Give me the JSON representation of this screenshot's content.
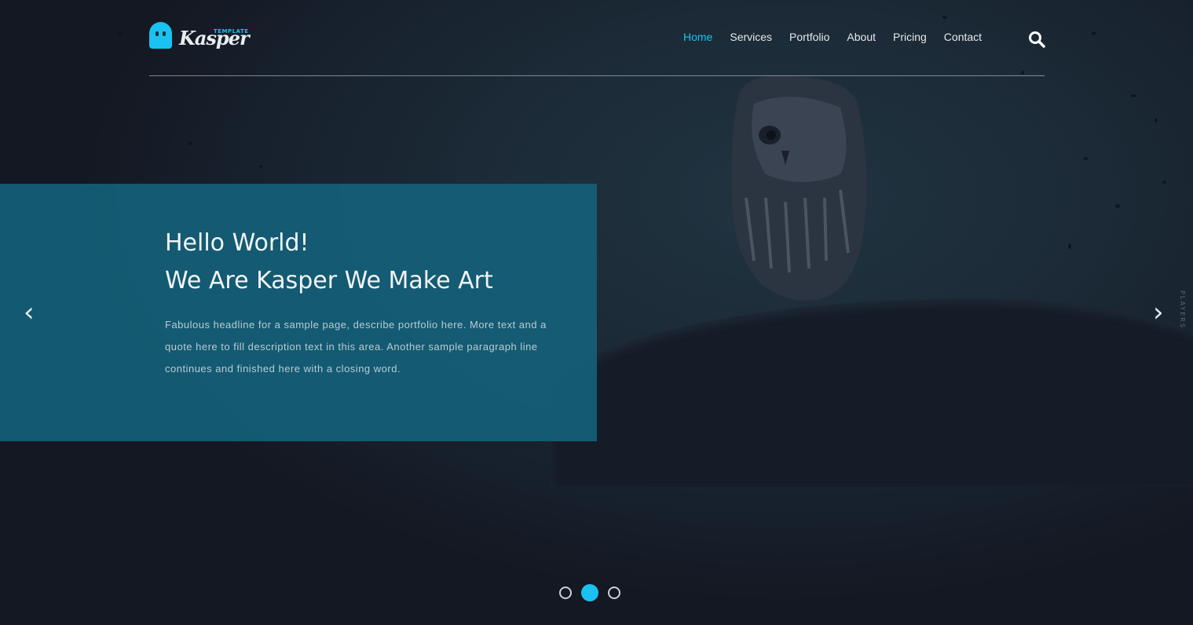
{
  "colors": {
    "accent": "#19c2f0",
    "caption_bg": "#145f78",
    "page_bg": "#141822"
  },
  "logo": {
    "text": "Kasper",
    "subtext": "TEMPLATE"
  },
  "nav": {
    "items": [
      {
        "label": "Home",
        "active": true
      },
      {
        "label": "Services",
        "active": false
      },
      {
        "label": "Portfolio",
        "active": false
      },
      {
        "label": "About",
        "active": false
      },
      {
        "label": "Pricing",
        "active": false
      },
      {
        "label": "Contact",
        "active": false
      }
    ],
    "search_icon": "search-icon"
  },
  "slide": {
    "title_line1": "Hello World!",
    "title_line2": "We Are Kasper We Make Art",
    "description": "Fabulous headline for a sample page, describe portfolio here. More text and a quote here to fill description text in this area. Another sample paragraph line continues and finished here with a closing word."
  },
  "slider": {
    "prev_icon": "chevron-left-icon",
    "next_icon": "chevron-right-icon",
    "side_label": "PLAYERS",
    "dots": [
      {
        "active": false
      },
      {
        "active": true
      },
      {
        "active": false
      }
    ]
  }
}
